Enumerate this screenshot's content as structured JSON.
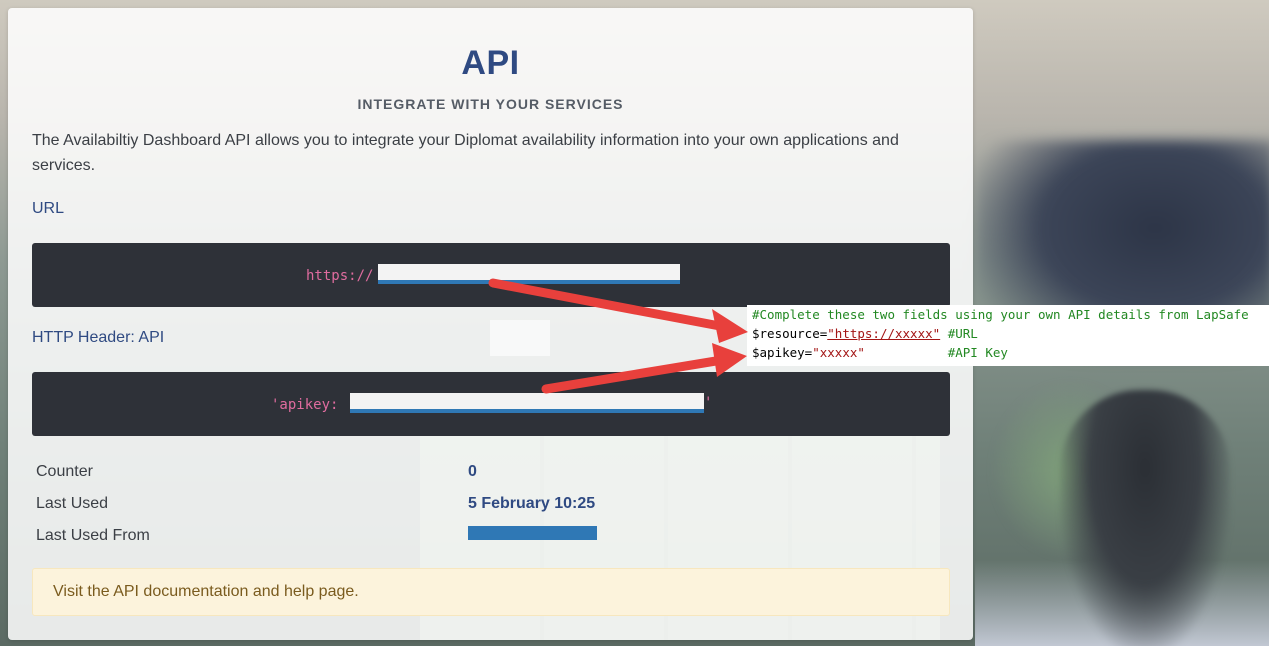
{
  "page": {
    "title": "API",
    "subtitle": "INTEGRATE WITH YOUR SERVICES",
    "intro": "The Availabiltiy Dashboard API allows you to integrate your Diplomat availability information into your own applications and services."
  },
  "url_section": {
    "label": "URL",
    "code_prefix": "https://"
  },
  "header_section": {
    "label": "HTTP Header: API",
    "code_prefix": "'apikey: ",
    "code_suffix": "'"
  },
  "stats": [
    {
      "label": "Counter",
      "value": "0"
    },
    {
      "label": "Last Used",
      "value": "5 February 10:25"
    },
    {
      "label": "Last Used From",
      "value": ""
    }
  ],
  "alert": {
    "text": "Visit the API documentation and help page."
  },
  "snippet": {
    "comment": "#Complete these two fields using your own API details from LapSafe",
    "resource_var": "$resource=",
    "resource_value": "\"https://xxxxx\"",
    "resource_comment": "#URL",
    "apikey_var": "$apikey=",
    "apikey_value": "\"xxxxx\"",
    "apikey_comment": "#API Key"
  },
  "colors": {
    "heading": "#2f4a82",
    "code_bg": "#2e3138",
    "code_text": "#e06c9f",
    "redaction_bar": "#2f78b5",
    "arrow": "#e8403c",
    "alert_bg": "#fcf3dc"
  }
}
